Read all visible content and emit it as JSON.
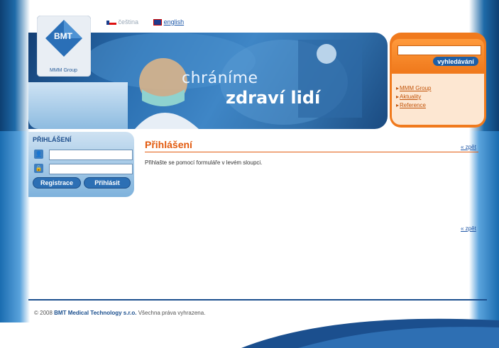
{
  "lang": {
    "czech": "čeština",
    "english": "english"
  },
  "logo": {
    "brand": "BMT",
    "group": "MMM Group"
  },
  "hero": {
    "line1": "chráníme",
    "line2": "zdraví lidí"
  },
  "search": {
    "input_value": "",
    "button": "vyhledávání"
  },
  "quick_links": [
    "MMM Group",
    "Aktuality",
    "Reference"
  ],
  "login": {
    "title": "PŘIHLÁŠENÍ",
    "register": "Registrace",
    "submit": "Přihlásit"
  },
  "content": {
    "title": "Přihlášení",
    "back_top": "« zpět",
    "text": "Přihlašte se pomocí formuláře v levém sloupci.",
    "back_bottom": "« zpět"
  },
  "footer": {
    "copy_prefix": "© 2008",
    "company": "BMT Medical Technology s.r.o.",
    "rights": "Všechna práva vyhrazena."
  },
  "colors": {
    "accent_orange": "#f07a1d",
    "brand_blue": "#1e5fa6",
    "title_orange": "#e25a0e"
  }
}
